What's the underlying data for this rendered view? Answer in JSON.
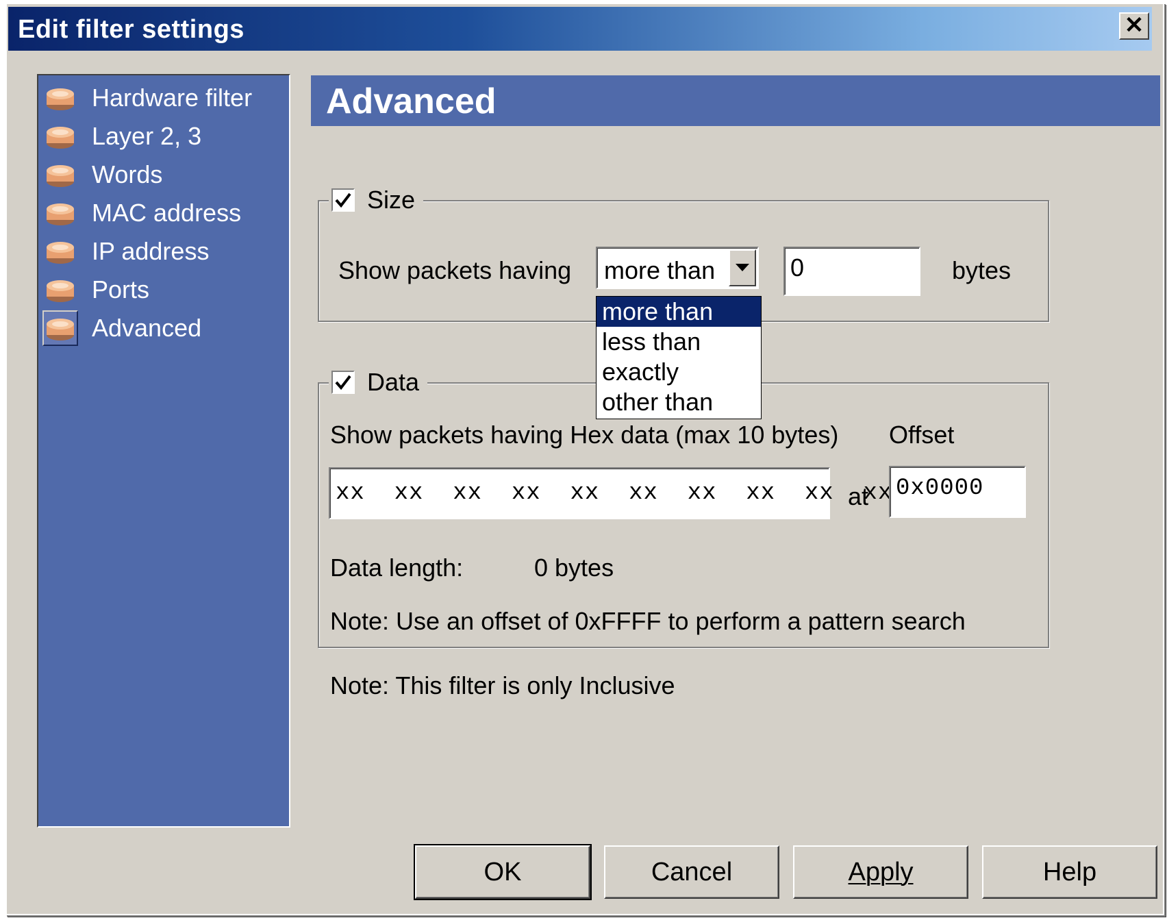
{
  "window": {
    "title": "Edit filter settings",
    "close_label": "✕"
  },
  "sidebar": {
    "items": [
      {
        "label": "Hardware filter"
      },
      {
        "label": "Layer 2, 3"
      },
      {
        "label": "Words"
      },
      {
        "label": "MAC address"
      },
      {
        "label": "IP address"
      },
      {
        "label": "Ports"
      },
      {
        "label": "Advanced",
        "selected": true
      }
    ]
  },
  "content": {
    "title": "Advanced"
  },
  "size_group": {
    "label": "Size",
    "checked": true,
    "show_label": "Show packets having",
    "comparison_value": "more than",
    "bytes_value": "0",
    "bytes_unit": "bytes",
    "dropdown_options": [
      "more than",
      "less than",
      "exactly",
      "other than"
    ]
  },
  "data_group": {
    "label": "Data",
    "checked": true,
    "hex_label": "Show packets having Hex data (max 10 bytes)",
    "offset_label": "Offset",
    "hex_value": "xx  xx  xx  xx  xx  xx  xx  xx  xx  xx",
    "at_label": "at",
    "offset_value": "0x0000",
    "length_label": "Data length:",
    "length_value": "0 bytes",
    "note": "Note: Use an offset of 0xFFFF to perform a pattern search"
  },
  "footer_note": "Note: This filter is only Inclusive",
  "buttons": {
    "ok": "OK",
    "cancel": "Cancel",
    "apply": "Apply",
    "help": "Help"
  },
  "colors": {
    "sidebar": "#506aaa",
    "titlebar": "#0a246a",
    "face": "#d4d0c8",
    "selection": "#0a246a"
  }
}
